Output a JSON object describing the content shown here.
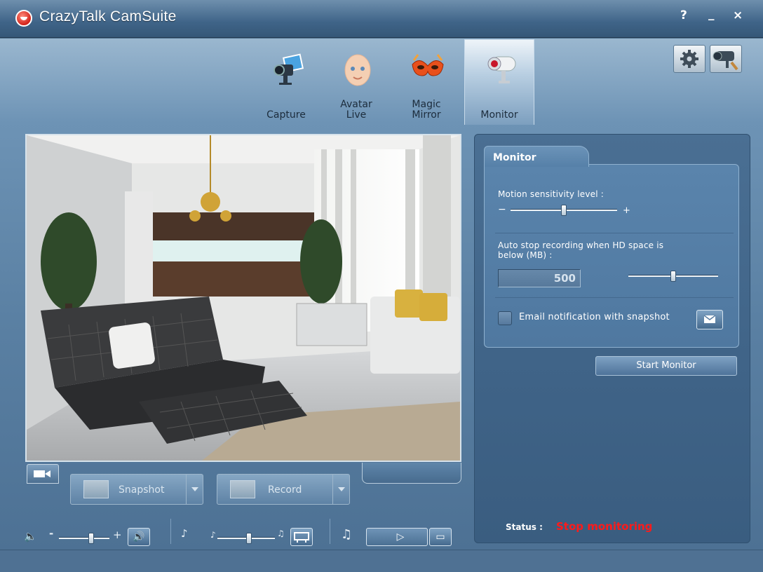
{
  "window": {
    "title": "CrazyTalk CamSuite",
    "help_label": "?",
    "minimize_label": "_",
    "close_label": "×"
  },
  "tabs": [
    {
      "label_lines": [
        "Capture"
      ],
      "active": false
    },
    {
      "label_lines": [
        "Avatar",
        "Live"
      ],
      "active": false
    },
    {
      "label_lines": [
        "Magic",
        "Mirror"
      ],
      "active": false
    },
    {
      "label_lines": [
        "Monitor"
      ],
      "active": true
    }
  ],
  "video_controls": {
    "snapshot_label": "Snapshot",
    "record_label": "Record"
  },
  "audio": {
    "volume_minus": "-",
    "volume_plus": "+",
    "volume_level": 0.65,
    "pitch_level": 0.55
  },
  "monitor_panel": {
    "tab_label": "Monitor",
    "sensitivity_label": "Motion sensitivity level :",
    "sensitivity_minus": "−",
    "sensitivity_plus": "+",
    "sensitivity_level": 0.5,
    "autostop_label_line1": "Auto stop recording when HD space is",
    "autostop_label_line2": "below (MB) :",
    "autostop_value": "500",
    "autostop_level": 0.5,
    "email_label": "Email notification with snapshot",
    "email_checked": false,
    "start_button_label": "Start Monitor",
    "status_label": "Status :",
    "status_value": "Stop monitoring"
  },
  "colors": {
    "status_value": "#ff1a1a",
    "accent": "#4f78a0"
  }
}
